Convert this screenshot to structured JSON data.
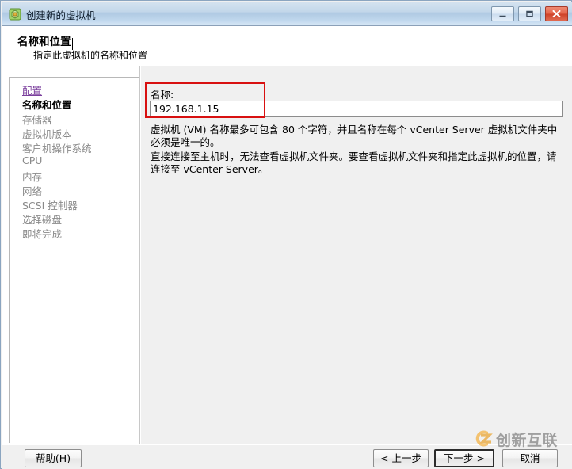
{
  "window": {
    "title": "创建新的虚拟机",
    "icon": "vm-app-icon",
    "controls": {
      "minimize": "minimize-icon",
      "maximize": "maximize-icon",
      "close": "close-icon"
    }
  },
  "header": {
    "title": "名称和位置",
    "subtitle": "指定此虚拟机的名称和位置"
  },
  "sidebar": {
    "items": [
      {
        "label": "配置",
        "state": "link"
      },
      {
        "label": "名称和位置",
        "state": "current"
      },
      {
        "label": "存储器",
        "state": "pending"
      },
      {
        "label": "虚拟机版本",
        "state": "pending"
      },
      {
        "label": "客户机操作系统",
        "state": "pending"
      },
      {
        "label": "CPU",
        "state": "pending"
      },
      {
        "label": "内存",
        "state": "pending"
      },
      {
        "label": "网络",
        "state": "pending"
      },
      {
        "label": "SCSI 控制器",
        "state": "pending"
      },
      {
        "label": "选择磁盘",
        "state": "pending"
      },
      {
        "label": "即将完成",
        "state": "pending"
      }
    ]
  },
  "main": {
    "name_label": "名称:",
    "name_value": "192.168.1.15",
    "name_placeholder": "",
    "paragraph_1": "虚拟机 (VM) 名称最多可包含 80 个字符，并且名称在每个 vCenter Server 虚拟机文件夹中必须是唯一的。",
    "paragraph_2": "直接连接至主机时，无法查看虚拟机文件夹。要查看虚拟机文件夹和指定此虚拟机的位置，请连接至 vCenter Server。"
  },
  "annotation": {
    "shape": "red-rectangle",
    "color": "#d81010"
  },
  "footer": {
    "help": "帮助(H)",
    "back": "< 上一步",
    "next": "下一步 >",
    "cancel": "取消"
  },
  "watermark": {
    "text": "创新互联",
    "logo": "swirl-logo-icon",
    "color": "#6e6e6e",
    "accent": "#f5a623"
  },
  "colors": {
    "titlebar_accent": "#b0cae3",
    "panel_bg": "#f0f0f0",
    "link": "#7b3f9d",
    "pending": "#8a8a8a",
    "close_button": "#cf4228"
  }
}
